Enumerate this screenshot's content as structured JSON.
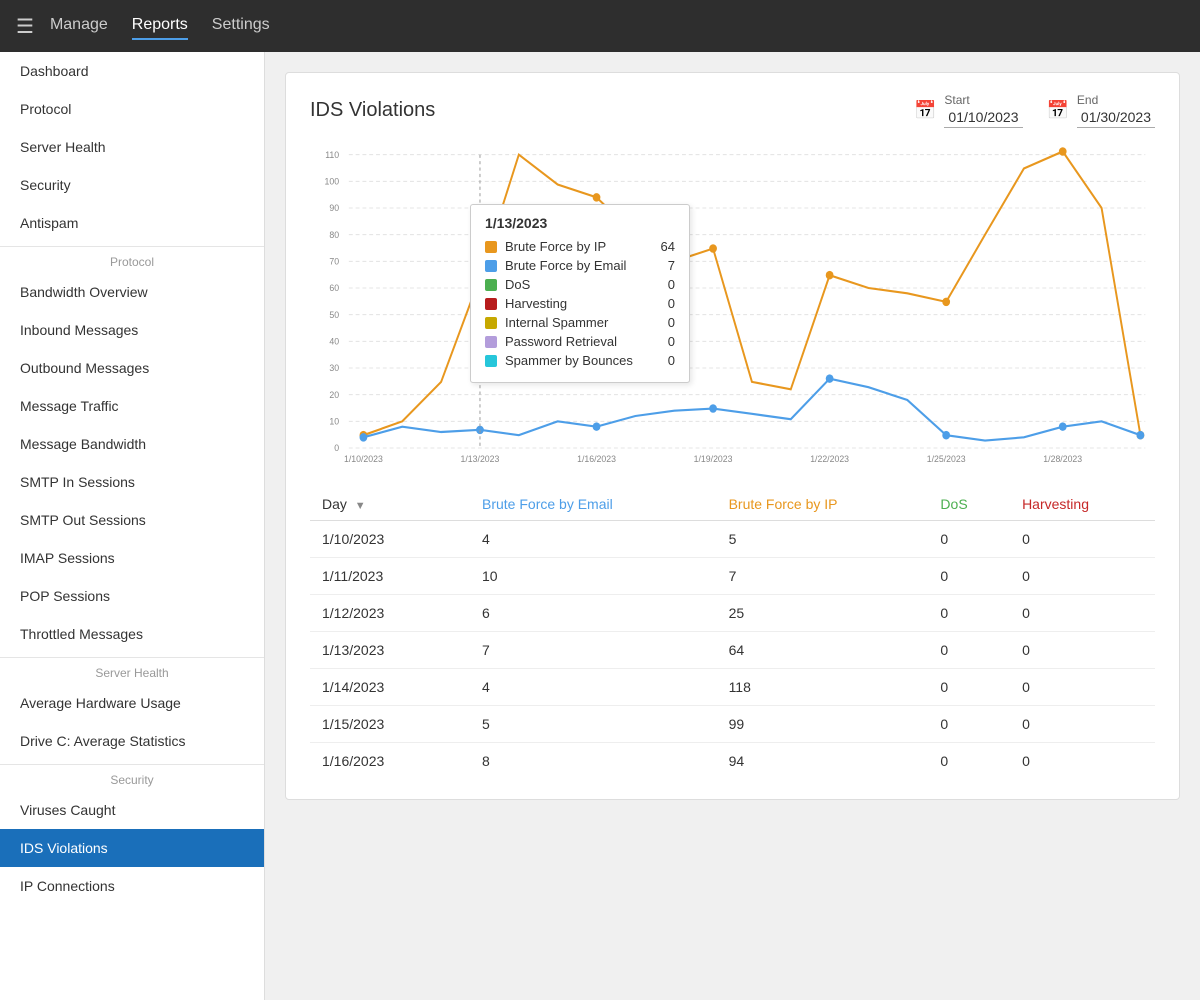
{
  "topnav": {
    "hamburger": "☰",
    "links": [
      {
        "label": "Manage",
        "active": false
      },
      {
        "label": "Reports",
        "active": true
      },
      {
        "label": "Settings",
        "active": false
      }
    ]
  },
  "sidebar": {
    "items": [
      {
        "label": "Dashboard",
        "active": false,
        "section": null
      },
      {
        "label": "Protocol",
        "active": false,
        "section": null
      },
      {
        "label": "Server Health",
        "active": false,
        "section": null
      },
      {
        "label": "Security",
        "active": false,
        "section": null
      },
      {
        "label": "Antispam",
        "active": false,
        "section": null
      },
      {
        "label": "Protocol",
        "type": "section"
      },
      {
        "label": "Bandwidth Overview",
        "active": false,
        "section": "Protocol"
      },
      {
        "label": "Inbound Messages",
        "active": false,
        "section": "Protocol"
      },
      {
        "label": "Outbound Messages",
        "active": false,
        "section": "Protocol"
      },
      {
        "label": "Message Traffic",
        "active": false,
        "section": "Protocol"
      },
      {
        "label": "Message Bandwidth",
        "active": false,
        "section": "Protocol"
      },
      {
        "label": "SMTP In Sessions",
        "active": false,
        "section": "Protocol"
      },
      {
        "label": "SMTP Out Sessions",
        "active": false,
        "section": "Protocol"
      },
      {
        "label": "IMAP Sessions",
        "active": false,
        "section": "Protocol"
      },
      {
        "label": "POP Sessions",
        "active": false,
        "section": "Protocol"
      },
      {
        "label": "Throttled Messages",
        "active": false,
        "section": "Protocol"
      },
      {
        "label": "Server Health",
        "type": "section"
      },
      {
        "label": "Average Hardware Usage",
        "active": false,
        "section": "Server Health"
      },
      {
        "label": "Drive C: Average Statistics",
        "active": false,
        "section": "Server Health"
      },
      {
        "label": "Security",
        "type": "section"
      },
      {
        "label": "Viruses Caught",
        "active": false,
        "section": "Security"
      },
      {
        "label": "IDS Violations",
        "active": true,
        "section": "Security"
      },
      {
        "label": "IP Connections",
        "active": false,
        "section": "Security"
      }
    ]
  },
  "main": {
    "title": "IDS Violations",
    "start_label": "Start",
    "start_date": "01/10/2023",
    "end_label": "End",
    "end_date": "01/30/2023",
    "tooltip": {
      "date": "1/13/2023",
      "rows": [
        {
          "label": "Brute Force by IP",
          "value": 64,
          "color": "#e8971e"
        },
        {
          "label": "Brute Force by Email",
          "value": 7,
          "color": "#4d9ee8"
        },
        {
          "label": "DoS",
          "value": 0,
          "color": "#4caf50"
        },
        {
          "label": "Harvesting",
          "value": 0,
          "color": "#b71c1c"
        },
        {
          "label": "Internal Spammer",
          "value": 0,
          "color": "#c6a800"
        },
        {
          "label": "Password Retrieval",
          "value": 0,
          "color": "#b39ddb"
        },
        {
          "label": "Spammer by Bounces",
          "value": 0,
          "color": "#26c6da"
        }
      ]
    },
    "table": {
      "columns": [
        {
          "label": "Day",
          "key": "day",
          "class": "col-day",
          "sortable": true
        },
        {
          "label": "Brute Force by Email",
          "key": "email",
          "class": "col-email",
          "sortable": false
        },
        {
          "label": "Brute Force by IP",
          "key": "ip",
          "class": "col-ip",
          "sortable": false
        },
        {
          "label": "DoS",
          "key": "dos",
          "class": "col-dos",
          "sortable": false
        },
        {
          "label": "Harvesting",
          "key": "harvesting",
          "class": "col-harvesting",
          "sortable": false
        }
      ],
      "rows": [
        {
          "day": "1/10/2023",
          "email": 4,
          "ip": 5,
          "dos": 0,
          "harvesting": 0
        },
        {
          "day": "1/11/2023",
          "email": 10,
          "ip": 7,
          "dos": 0,
          "harvesting": 0
        },
        {
          "day": "1/12/2023",
          "email": 6,
          "ip": 25,
          "dos": 0,
          "harvesting": 0
        },
        {
          "day": "1/13/2023",
          "email": 7,
          "ip": 64,
          "dos": 0,
          "harvesting": 0
        },
        {
          "day": "1/14/2023",
          "email": 4,
          "ip": 118,
          "dos": 0,
          "harvesting": 0
        },
        {
          "day": "1/15/2023",
          "email": 5,
          "ip": 99,
          "dos": 0,
          "harvesting": 0
        },
        {
          "day": "1/16/2023",
          "email": 8,
          "ip": 94,
          "dos": 0,
          "harvesting": 0
        }
      ]
    }
  }
}
